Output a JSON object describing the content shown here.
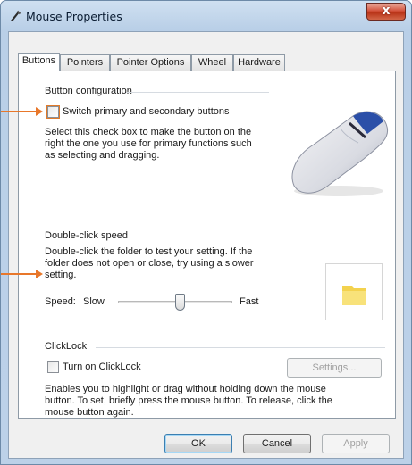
{
  "window": {
    "title": "Mouse Properties",
    "close_glyph": "x"
  },
  "tabs": [
    {
      "label": "Buttons",
      "active": true
    },
    {
      "label": "Pointers",
      "active": false
    },
    {
      "label": "Pointer Options",
      "active": false
    },
    {
      "label": "Wheel",
      "active": false
    },
    {
      "label": "Hardware",
      "active": false
    }
  ],
  "button_configuration": {
    "heading": "Button configuration",
    "checkbox_label": "Switch primary and secondary buttons",
    "checked": false,
    "description": [
      "Select this check box to make the button on the",
      "right the one you use for primary functions such",
      "as selecting and dragging."
    ]
  },
  "double_click": {
    "heading": "Double-click speed",
    "description": [
      "Double-click the folder to test your setting. If the",
      "folder does not open or close, try using a slower",
      "setting."
    ],
    "speed_label": "Speed:",
    "slow_label": "Slow",
    "fast_label": "Fast",
    "slider_value_fraction": 0.55
  },
  "clicklock": {
    "heading": "ClickLock",
    "checkbox_label": "Turn on ClickLock",
    "checked": false,
    "settings_button": "Settings...",
    "description": [
      "Enables you to highlight or drag without holding down the mouse",
      "button. To set, briefly press the mouse button. To release, click the",
      "mouse button again."
    ]
  },
  "footer": {
    "ok": "OK",
    "cancel": "Cancel",
    "apply": "Apply"
  },
  "colors": {
    "annotation_arrow": "#e8772a",
    "accent": "#3c7fb1"
  },
  "icons": [
    "mouse-pointer-icon",
    "close-icon",
    "mouse-image-icon",
    "folder-icon"
  ]
}
